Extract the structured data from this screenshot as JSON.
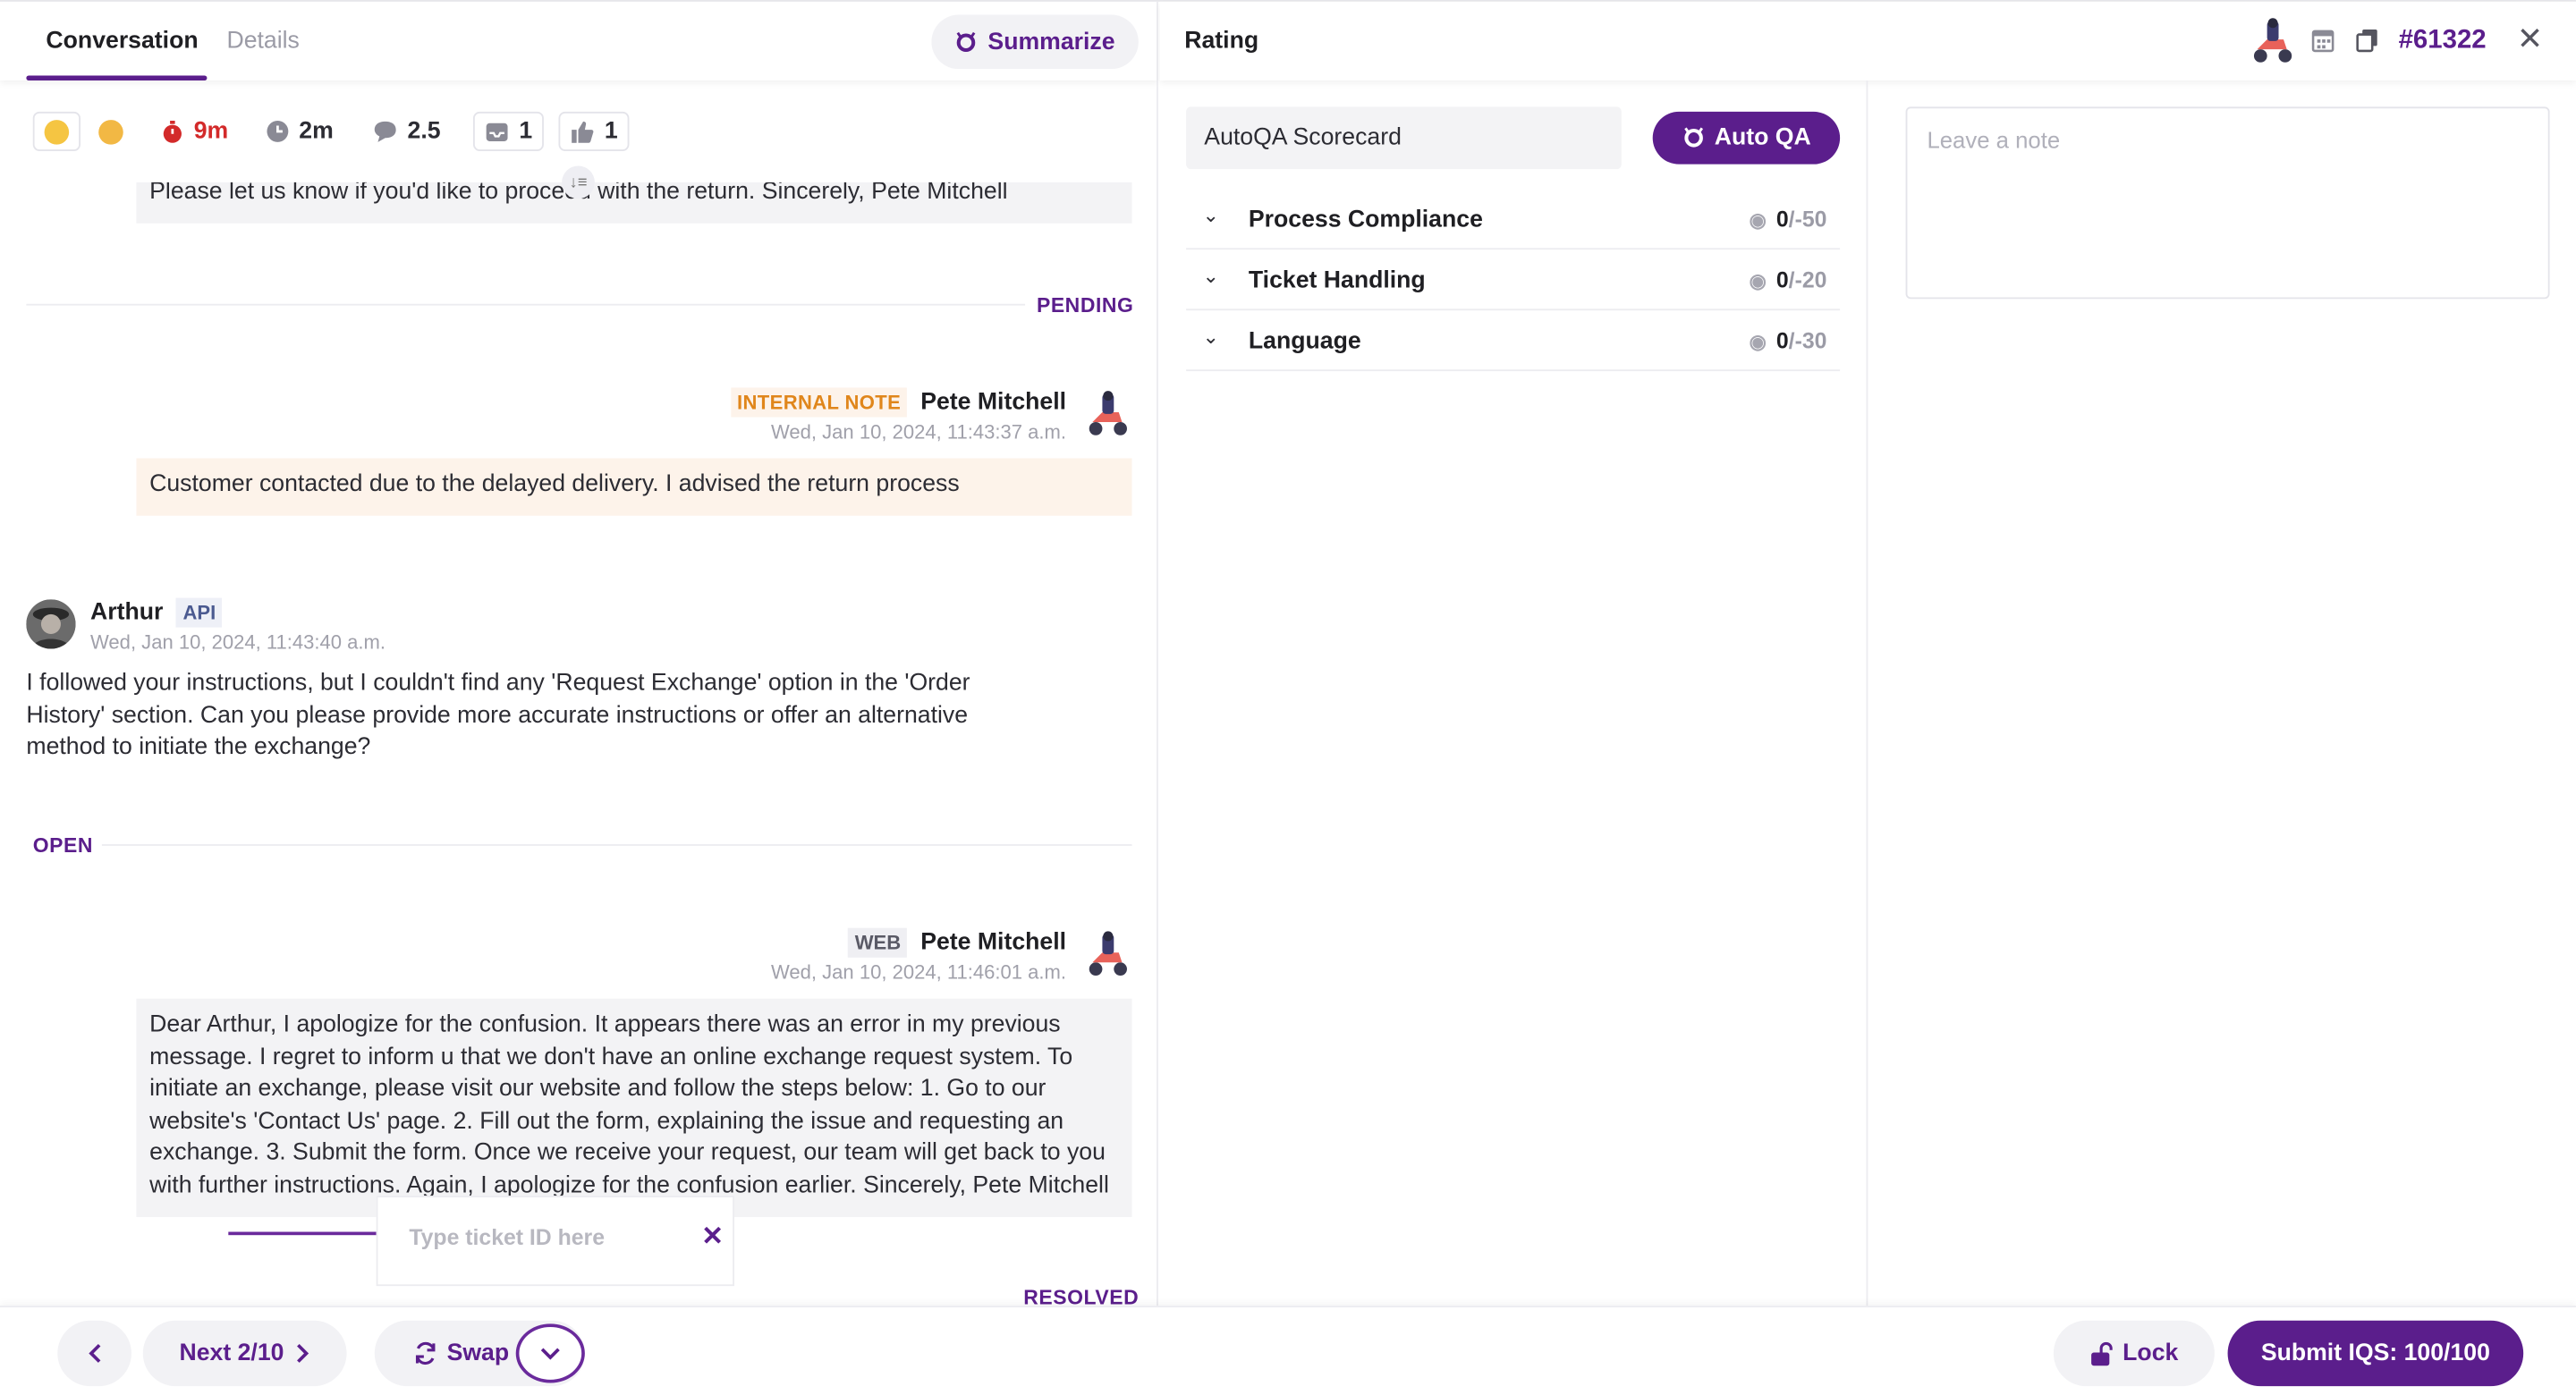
{
  "left": {
    "tabs": [
      {
        "label": "Conversation",
        "active": true
      },
      {
        "label": "Details",
        "active": false
      }
    ],
    "summarize_label": "Summarize",
    "metrics": {
      "duration": "9m",
      "response_time": "2m",
      "messages": "2.5",
      "inbox_count": "1",
      "likes": "1"
    },
    "messages": [
      {
        "text": "Please let us know if you'd like to proceed with the return. Sincerely, Pete Mitchell"
      },
      {
        "status": "PENDING"
      },
      {
        "author": "Pete Mitchell",
        "badge": "INTERNAL NOTE",
        "time": "Wed, Jan 10, 2024, 11:43:37 a.m.",
        "text": "Customer contacted due to the delayed delivery. I advised the return process"
      },
      {
        "author": "Arthur",
        "badge": "API",
        "time": "Wed, Jan 10, 2024, 11:43:40 a.m.",
        "text": "I followed your instructions, but I couldn't find any 'Request Exchange' option in the 'Order History' section. Can you please provide more accurate instructions or offer an alternative method to initiate the exchange?"
      },
      {
        "status": "OPEN"
      },
      {
        "author": "Pete Mitchell",
        "badge": "WEB",
        "time": "Wed, Jan 10, 2024, 11:46:01 a.m.",
        "text": "Dear Arthur, I apologize for the confusion. It appears there was an error in my previous message. I regret to inform u that we don't have an online exchange request system. To initiate an exchange, please visit our website and follow the steps below: 1. Go to our website's 'Contact Us' page. 2. Fill out the form, explaining the issue and requesting an exchange. 3. Submit the form. Once we receive your request, our team will get back to you with further instructions. Again, I apologize for the confusion earlier. Sincerely, Pete Mitchell"
      },
      {
        "status": "RESOLVED"
      }
    ],
    "ticket_input_placeholder": "Type ticket ID here"
  },
  "right": {
    "title": "Rating",
    "ticket_number": "#61322",
    "scorecard": "AutoQA Scorecard",
    "autoqa_label": "Auto QA",
    "categories": [
      {
        "name": "Process Compliance",
        "score": "0",
        "max": "/-50"
      },
      {
        "name": "Ticket Handling",
        "score": "0",
        "max": "/-20"
      },
      {
        "name": "Language",
        "score": "0",
        "max": "/-30"
      }
    ],
    "note_placeholder": "Leave a note"
  },
  "footer": {
    "next_label": "Next 2/10",
    "swap_label": "Swap",
    "lock_label": "Lock",
    "submit_label": "Submit IQS: 100/100"
  },
  "colors": {
    "brand": "#5b1e8c",
    "internal_note": "#e0861b",
    "timer": "#d32a2a"
  },
  "icons": [
    "smile-emoji-icon",
    "party-emoji-icon",
    "stopwatch-icon",
    "clock-icon",
    "chat-bubble-icon",
    "inbox-icon",
    "thumbs-up-icon",
    "ai-spark-icon",
    "calendar-icon",
    "copy-icon",
    "close-icon",
    "chevron-down-icon",
    "chevron-left-icon",
    "chevron-right-icon",
    "swap-icon",
    "lock-icon",
    "scooter-avatar-icon"
  ]
}
